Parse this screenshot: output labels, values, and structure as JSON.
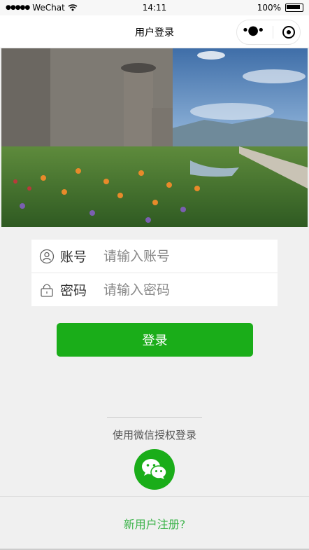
{
  "status_bar": {
    "carrier": "WeChat",
    "time": "14:11",
    "battery": "100%"
  },
  "nav": {
    "title": "用户登录"
  },
  "banner": {
    "alt": "castle-garden-photo"
  },
  "form": {
    "account": {
      "label": "账号",
      "placeholder": "请输入账号",
      "icon": "user-icon"
    },
    "password": {
      "label": "密码",
      "placeholder": "请输入密码",
      "icon": "lock-icon"
    }
  },
  "login_button": {
    "label": "登录"
  },
  "wechat": {
    "hint": "使用微信授权登录",
    "icon": "wechat-icon"
  },
  "register": {
    "label": "新用户注册?"
  },
  "colors": {
    "primary": "#1aad19",
    "link": "#3cb34a"
  }
}
